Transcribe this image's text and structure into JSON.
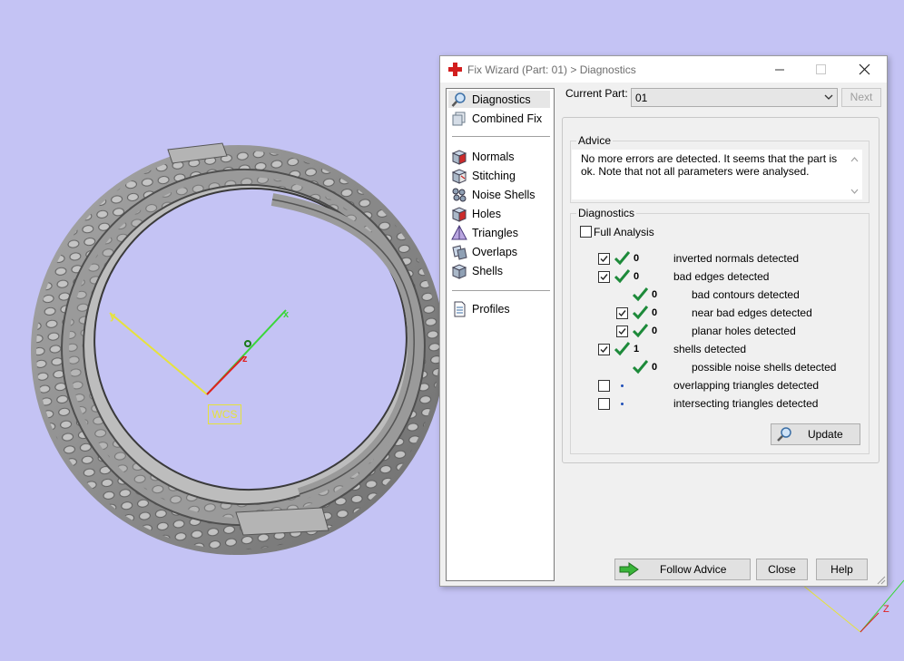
{
  "viewport": {
    "wcs_label": "WCS",
    "axis_x": "x",
    "axis_y": "y",
    "axis_z": "z",
    "corner_axis_z": "Z"
  },
  "window": {
    "title": "Fix Wizard (Part: 01) > Diagnostics"
  },
  "nav": {
    "items": [
      {
        "label": "Diagnostics",
        "icon": "magnifier-icon",
        "selected": true
      },
      {
        "label": "Combined Fix",
        "icon": "layers-icon"
      },
      {
        "label": "Normals",
        "icon": "normals-cube-icon"
      },
      {
        "label": "Stitching",
        "icon": "stitching-cube-icon"
      },
      {
        "label": "Noise Shells",
        "icon": "noise-shells-icon"
      },
      {
        "label": "Holes",
        "icon": "holes-cube-icon"
      },
      {
        "label": "Triangles",
        "icon": "triangles-icon"
      },
      {
        "label": "Overlaps",
        "icon": "overlaps-icon"
      },
      {
        "label": "Shells",
        "icon": "shells-icon"
      },
      {
        "label": "Profiles",
        "icon": "document-icon"
      }
    ]
  },
  "current_part": {
    "label": "Current Part:",
    "value": "01"
  },
  "buttons": {
    "next": "Next",
    "update": "Update",
    "follow_advice": "Follow Advice",
    "close": "Close",
    "help": "Help"
  },
  "advice": {
    "title": "Advice",
    "text": "No more errors are detected. It seems that the part is ok. Note that not all parameters were analysed."
  },
  "diagnostics": {
    "title": "Diagnostics",
    "full_analysis_label": "Full Analysis",
    "full_analysis_checked": false,
    "rows": [
      {
        "checkbox": true,
        "checked": true,
        "status": "ok",
        "count": "0",
        "label": "inverted normals detected",
        "indent": 0
      },
      {
        "checkbox": true,
        "checked": true,
        "status": "ok",
        "count": "0",
        "label": "bad edges detected",
        "indent": 0
      },
      {
        "checkbox": false,
        "checked": false,
        "status": "ok",
        "count": "0",
        "label": "bad contours detected",
        "indent": 1
      },
      {
        "checkbox": true,
        "checked": true,
        "status": "ok",
        "count": "0",
        "label": "near bad edges detected",
        "indent": 1
      },
      {
        "checkbox": true,
        "checked": true,
        "status": "ok",
        "count": "0",
        "label": "planar holes detected",
        "indent": 1
      },
      {
        "checkbox": true,
        "checked": true,
        "status": "ok",
        "count": "1",
        "label": "shells detected",
        "indent": 0
      },
      {
        "checkbox": false,
        "checked": false,
        "status": "ok",
        "count": "0",
        "label": "possible noise shells detected",
        "indent": 1
      },
      {
        "checkbox": true,
        "checked": false,
        "status": "pending",
        "count": "",
        "label": "overlapping triangles detected",
        "indent": 0
      },
      {
        "checkbox": true,
        "checked": false,
        "status": "pending",
        "count": "",
        "label": "intersecting triangles detected",
        "indent": 0
      }
    ]
  },
  "colors": {
    "background": "#c4c3f4",
    "ok_check": "#1d8a3a",
    "axis_x": "#39d639",
    "axis_y": "#e6e23c",
    "axis_z": "#e02020"
  }
}
